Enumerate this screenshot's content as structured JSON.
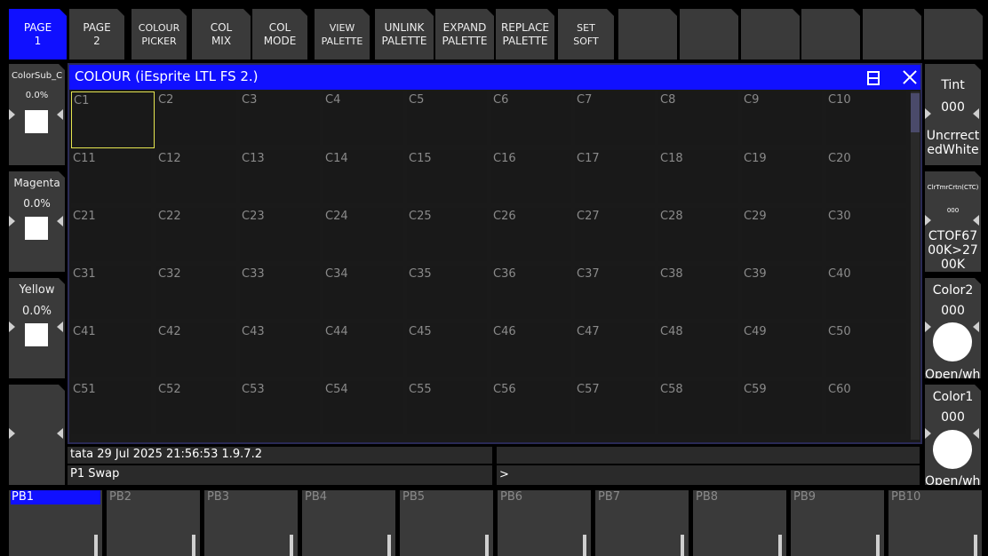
{
  "toolbar": [
    {
      "id": "page-1",
      "lines": [
        "PAGE",
        "1"
      ],
      "active": true
    },
    {
      "id": "page-2",
      "lines": [
        "PAGE",
        "2"
      ],
      "active": false
    },
    {
      "id": "colour-picker",
      "lines": [
        "COLOUR",
        "PICKER"
      ],
      "active": false
    },
    {
      "id": "col-mix",
      "lines": [
        "COL",
        "MIX"
      ],
      "active": false
    },
    {
      "id": "col-mode",
      "lines": [
        "COL",
        "MODE"
      ],
      "active": false
    },
    {
      "id": "view-palette",
      "lines": [
        "VIEW",
        "PALETTE"
      ],
      "active": false
    },
    {
      "id": "unlink-palette",
      "lines": [
        "UNLINK",
        "PALETTE"
      ],
      "active": false
    },
    {
      "id": "expand-palette",
      "lines": [
        "EXPAND",
        "PALETTE"
      ],
      "active": false
    },
    {
      "id": "replace-palette",
      "lines": [
        "REPLACE",
        "PALETTE"
      ],
      "active": false
    },
    {
      "id": "set-soft",
      "lines": [
        "SET",
        "SOFT"
      ],
      "active": false
    },
    {
      "id": "blank-1",
      "lines": [
        "",
        ""
      ],
      "active": false
    },
    {
      "id": "blank-2",
      "lines": [
        "",
        ""
      ],
      "active": false
    },
    {
      "id": "blank-3",
      "lines": [
        "",
        ""
      ],
      "active": false
    },
    {
      "id": "blank-4",
      "lines": [
        "",
        ""
      ],
      "active": false
    },
    {
      "id": "blank-5",
      "lines": [
        "",
        ""
      ],
      "active": false
    },
    {
      "id": "blank-6",
      "lines": [
        "",
        ""
      ],
      "active": false
    }
  ],
  "left_encoders": [
    {
      "title": "ColorSub_C",
      "value": "0.0%"
    },
    {
      "title": "Magenta",
      "value": "0.0%"
    },
    {
      "title": "Yellow",
      "value": "0.0%"
    },
    {
      "title": "",
      "value": ""
    }
  ],
  "right_encoders": [
    {
      "title": "Tint",
      "value": "000",
      "line1": "Uncrrect",
      "line2": "edWhite",
      "line3": ""
    },
    {
      "title": "ClrTmrCrtn(CTC)",
      "value": "000",
      "line1": "CTOF67",
      "line2": "00K>27",
      "line3": "00K"
    },
    {
      "title": "Color2",
      "value": "000",
      "line1": "Open/whit",
      "line2": "",
      "line3": ""
    },
    {
      "title": "Color1",
      "value": "000",
      "line1": "Open/whit",
      "line2": "",
      "line3": ""
    }
  ],
  "window": {
    "title": "COLOUR (iEsprite LTL FS 2.)",
    "cells": [
      "C1",
      "C2",
      "C3",
      "C4",
      "C5",
      "C6",
      "C7",
      "C8",
      "C9",
      "C10",
      "C11",
      "C12",
      "C13",
      "C14",
      "C15",
      "C16",
      "C17",
      "C18",
      "C19",
      "C20",
      "C21",
      "C22",
      "C23",
      "C24",
      "C25",
      "C26",
      "C27",
      "C28",
      "C29",
      "C30",
      "C31",
      "C32",
      "C33",
      "C34",
      "C35",
      "C36",
      "C37",
      "C38",
      "C39",
      "C40",
      "C41",
      "C42",
      "C43",
      "C44",
      "C45",
      "C46",
      "C47",
      "C48",
      "C49",
      "C50",
      "C51",
      "C52",
      "C53",
      "C54",
      "C55",
      "C56",
      "C57",
      "C58",
      "C59",
      "C60"
    ],
    "selected": "C1"
  },
  "status": {
    "line": "tata 29 Jul 2025 21:56:53 1.9.7.2",
    "command": "P1  Swap",
    "prompt": ">"
  },
  "playbacks": [
    "PB1",
    "PB2",
    "PB3",
    "PB4",
    "PB5",
    "PB6",
    "PB7",
    "PB8",
    "PB9",
    "PB10"
  ],
  "colors": {
    "accent": "#1010ff",
    "panel": "#3a3a3a",
    "cell": "#191919",
    "selection": "#e6e650"
  }
}
